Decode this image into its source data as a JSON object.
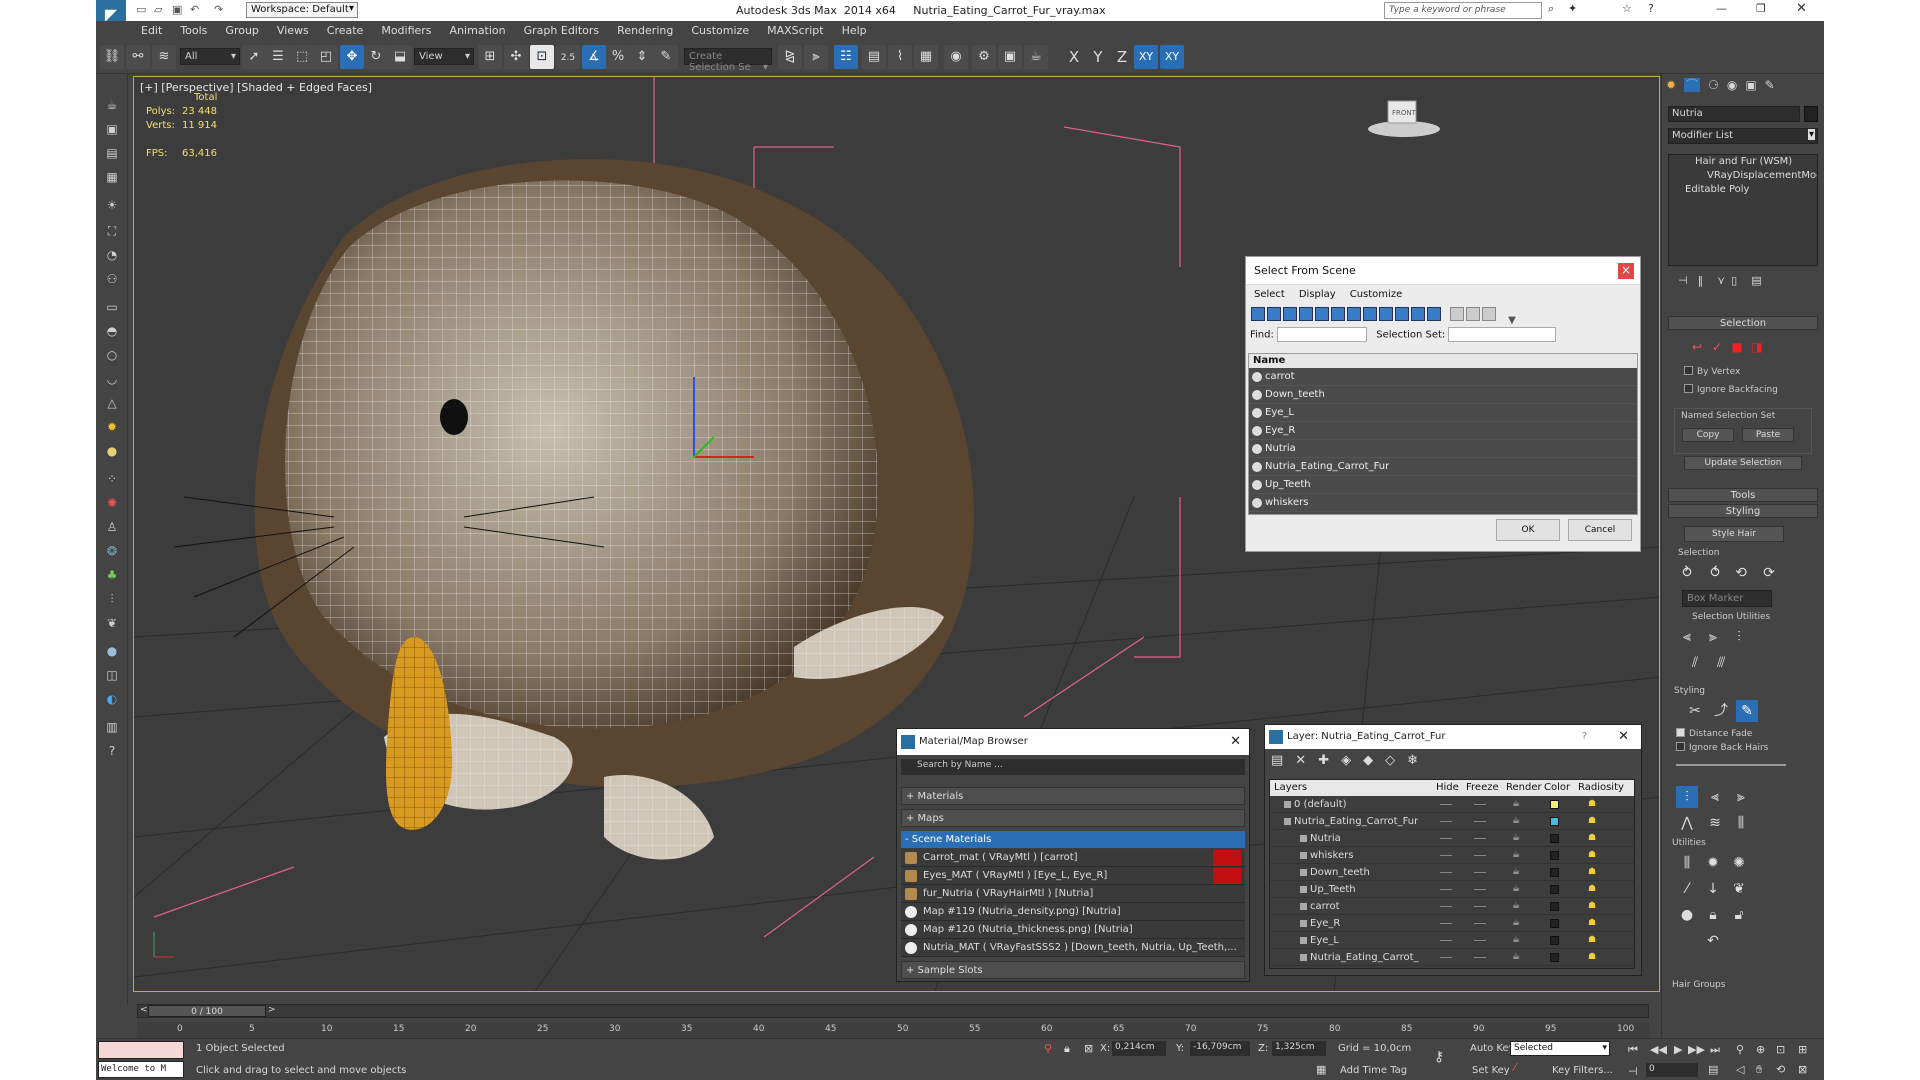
{
  "titlebar": {
    "workspace": "Workspace: Default",
    "title": "Autodesk 3ds Max  2014 x64     Nutria_Eating_Carrot_Fur_vray.max",
    "search_placeholder": "Type a keyword or phrase"
  },
  "menu": [
    "Edit",
    "Tools",
    "Group",
    "Views",
    "Create",
    "Modifiers",
    "Animation",
    "Graph Editors",
    "Rendering",
    "Customize",
    "MAXScript",
    "Help"
  ],
  "toolbar": {
    "filter": "All",
    "refcoord": "View",
    "angle": "2.5",
    "selection_set": "Create Selection Se",
    "axes": [
      "X",
      "Y",
      "Z",
      "XY",
      "XY"
    ]
  },
  "viewport": {
    "label": "[+] [Perspective] [Shaded + Edged Faces]",
    "total": "Total",
    "polys_label": "Polys:",
    "polys": "23 448",
    "verts_label": "Verts:",
    "verts": "11 914",
    "fps_label": "FPS:",
    "fps": "63,416",
    "viewcube": "FRONT"
  },
  "select_dialog": {
    "title": "Select From Scene",
    "menu": [
      "Select",
      "Display",
      "Customize"
    ],
    "find_label": "Find:",
    "selset_label": "Selection Set:",
    "column": "Name",
    "items": [
      "carrot",
      "Down_teeth",
      "Eye_L",
      "Eye_R",
      "Nutria",
      "Nutria_Eating_Carrot_Fur",
      "Up_Teeth",
      "whiskers"
    ],
    "ok": "OK",
    "cancel": "Cancel"
  },
  "material_browser": {
    "title": "Material/Map Browser",
    "search": "Search by Name ...",
    "sections": [
      "+ Materials",
      "+ Maps",
      "- Scene Materials"
    ],
    "items": [
      "Carrot_mat  ( VRayMtl )  [carrot]",
      "Eyes_MAT  ( VRayMtl )  [Eye_L, Eye_R]",
      "fur_Nutria  ( VRayHairMtl )  [Nutria]",
      "Map #119 (Nutria_density.png)  [Nutria]",
      "Map #120 (Nutria_thickness.png)  [Nutria]",
      "Nutria_MAT  ( VRayFastSSS2 )  [Down_teeth, Nutria, Up_Teeth,..."
    ],
    "samples": "+ Sample Slots"
  },
  "layer_panel": {
    "title": "Layer: Nutria_Eating_Carrot_Fur",
    "help": "?",
    "headers": [
      "Layers",
      "Hide",
      "Freeze",
      "Render",
      "Color",
      "Radiosity"
    ],
    "rows": [
      "0 (default)",
      "Nutria_Eating_Carrot_Fur",
      "Nutria",
      "whiskers",
      "Down_teeth",
      "Up_Teeth",
      "carrot",
      "Eye_R",
      "Eye_L",
      "Nutria_Eating_Carrot_"
    ]
  },
  "cmd": {
    "object_name": "Nutria",
    "modifier_list": "Modifier List",
    "stack": [
      "Hair and Fur (WSM)",
      "VRayDisplacementMod",
      "Editable Poly"
    ],
    "selection": "Selection",
    "by_vertex": "By Vertex",
    "ignore_backfacing": "Ignore Backfacing",
    "named_sel": "Named Selection Set",
    "copy": "Copy",
    "paste": "Paste",
    "update_sel": "Update Selection",
    "tools": "Tools",
    "styling": "Styling",
    "style_hair": "Style Hair",
    "sub_selection": "Selection",
    "box_marker": "Box Marker",
    "sel_utils": "Selection Utilities",
    "sub_styling": "Styling",
    "distance_fade": "Distance Fade",
    "ignore_back_hairs": "Ignore Back Hairs",
    "utilities": "Utilities",
    "hair_groups": "Hair Groups"
  },
  "timeline": {
    "frame": "0 / 100",
    "ticks": [
      "0",
      "5",
      "10",
      "15",
      "20",
      "25",
      "30",
      "35",
      "40",
      "45",
      "50",
      "55",
      "60",
      "65",
      "70",
      "75",
      "80",
      "85",
      "90",
      "95",
      "100"
    ]
  },
  "status": {
    "maxscript": "Welcome to M",
    "selected": "1 Object Selected",
    "prompt": "Click and drag to select and move objects",
    "x_label": "X:",
    "x": "0,214cm",
    "y_label": "Y:",
    "y": "-16,709cm",
    "z_label": "Z:",
    "z": "1,325cm",
    "grid": "Grid = 10,0cm",
    "add_time_tag": "Add Time Tag",
    "auto_key": "Auto Key",
    "set_key": "Set Key",
    "selected_combo": "Selected",
    "key_filters": "Key Filters...",
    "frame_field": "0"
  }
}
